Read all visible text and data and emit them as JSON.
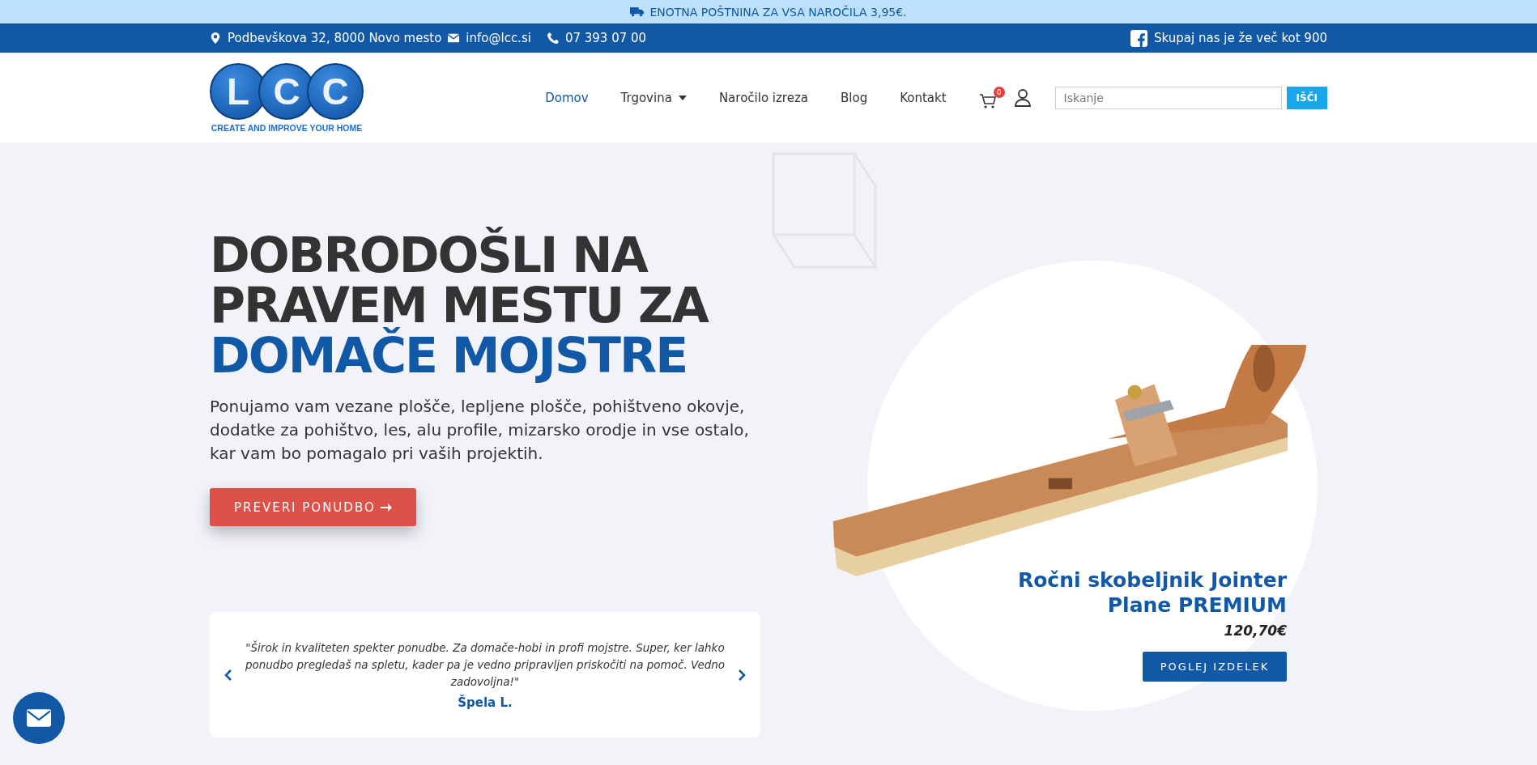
{
  "announcement": "ENOTNA POŠTNINA ZA VSA NAROČILA 3,95€.",
  "topbar": {
    "address": "Podbevškova 32, 8000 Novo mesto",
    "email": "info@lcc.si",
    "phone": "07 393 07 00",
    "social": "Skupaj nas je že več kot 900"
  },
  "logo": {
    "letters": [
      "L",
      "C",
      "C"
    ],
    "tagline": "CREATE AND IMPROVE YOUR HOME"
  },
  "nav": [
    {
      "label": "Domov",
      "selected": true,
      "dropdown": false
    },
    {
      "label": "Trgovina",
      "selected": false,
      "dropdown": true
    },
    {
      "label": "Naročilo izreza",
      "selected": false,
      "dropdown": false
    },
    {
      "label": "Blog",
      "selected": false,
      "dropdown": false
    },
    {
      "label": "Kontakt",
      "selected": false,
      "dropdown": false
    }
  ],
  "cart_count": "0",
  "search": {
    "placeholder": "Iskanje",
    "button": "IŠČI"
  },
  "hero": {
    "lines": [
      {
        "text": "DOBRODOŠLI NA",
        "accent": false
      },
      {
        "text": "PRAVEM MESTU ZA",
        "accent": false
      },
      {
        "text": "DOMAČE MOJSTRE",
        "accent": true
      }
    ],
    "text": "Ponujamo vam vezane plošče, lepljene plošče, pohištveno okovje, dodatke za pohištvo, les, alu profile, mizarsko orodje in vse ostalo, kar vam bo pomagalo pri vaših projektih.",
    "button": "PREVERI PONUDBO"
  },
  "testimonial": {
    "quote": "\"Širok in kvaliteten spekter ponudbe. Za domače-hobi in profi mojstre. Super, ker lahko ponudbo pregledaš na spletu, kader pa je vedno pripravljen priskočiti na pomoč. Vedno zadovoljna!\"",
    "author": "Špela L."
  },
  "product": {
    "name": "Ročni skobeljnik Jointer Plane PREMIUM",
    "price": "120,70€",
    "button": "POGLEJ IZDELEK"
  }
}
